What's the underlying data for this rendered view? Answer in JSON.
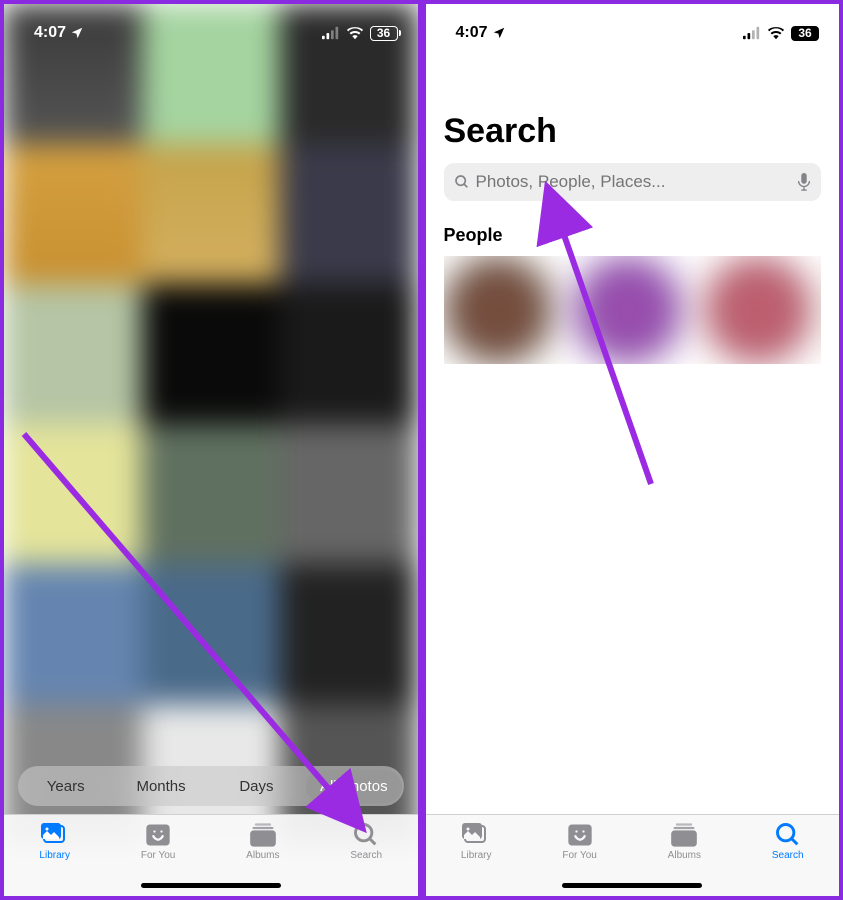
{
  "status": {
    "time": "4:07",
    "battery": "36"
  },
  "left": {
    "segments": {
      "years": "Years",
      "months": "Months",
      "days": "Days",
      "all": "All Photos"
    },
    "tabs": {
      "library": "Library",
      "foryou": "For You",
      "albums": "Albums",
      "search": "Search"
    }
  },
  "right": {
    "title": "Search",
    "search_placeholder": "Photos, People, Places...",
    "people_title": "People",
    "tabs": {
      "library": "Library",
      "foryou": "For You",
      "albums": "Albums",
      "search": "Search"
    }
  }
}
